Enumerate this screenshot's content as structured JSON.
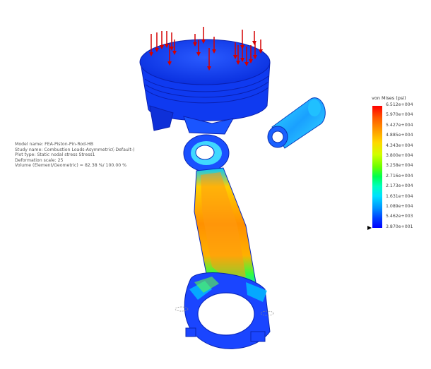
{
  "model_info": {
    "model_name": "Model name: FEA-Piston-Pin-Rod-HB",
    "study_name": "Study name: Combustion Loads-Asymmetric(-Default-)",
    "plot_type": "Plot type: Static nodal stress Stress1",
    "deformation_scale": "Deformation scale: 25",
    "volume": "Volume (Element/Geometric) = 82.38 %/ 100.00 %"
  },
  "legend": {
    "title": "von Mises (psi)",
    "ticks": [
      "6.512e+004",
      "5.970e+004",
      "5.427e+004",
      "4.885e+004",
      "4.343e+004",
      "3.800e+004",
      "3.258e+004",
      "2.716e+004",
      "2.173e+004",
      "1.631e+004",
      "1.089e+004",
      "5.462e+003",
      "3.870e+001"
    ],
    "colors": {
      "max": "#ff0000",
      "mid": "#00ff50",
      "min": "#0000ff"
    }
  },
  "scene": {
    "load_arrow_color": "#d40000",
    "part_color": "#1a3ff0"
  }
}
